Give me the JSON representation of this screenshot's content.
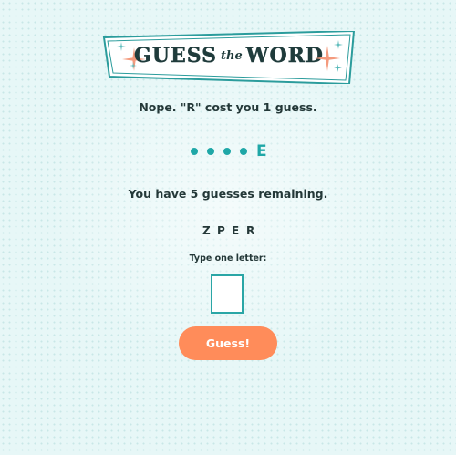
{
  "title": {
    "guess": "GUESS",
    "the": "the",
    "word": "WORD"
  },
  "message": "Nope. \"R\" cost you 1 guess.",
  "word_display": {
    "slots": [
      {
        "revealed": false,
        "letter": ""
      },
      {
        "revealed": false,
        "letter": ""
      },
      {
        "revealed": false,
        "letter": ""
      },
      {
        "revealed": false,
        "letter": ""
      },
      {
        "revealed": true,
        "letter": "E"
      }
    ]
  },
  "guesses_remaining_text": "You have 5 guesses remaining.",
  "guessed_letters": [
    "Z",
    "P",
    "E",
    "R"
  ],
  "input": {
    "prompt": "Type one letter:",
    "value": ""
  },
  "guess_button": {
    "label": "Guess!"
  },
  "colors": {
    "accent_teal": "#1fa7a7",
    "button_orange": "#ff8c5a",
    "sparkle_orange": "#f49a7d",
    "sparkle_teal": "#54b8b8",
    "background": "#e7f7f7"
  },
  "icons": {
    "banner_left": "sparkle-icon",
    "banner_right": "sparkle-icon"
  }
}
